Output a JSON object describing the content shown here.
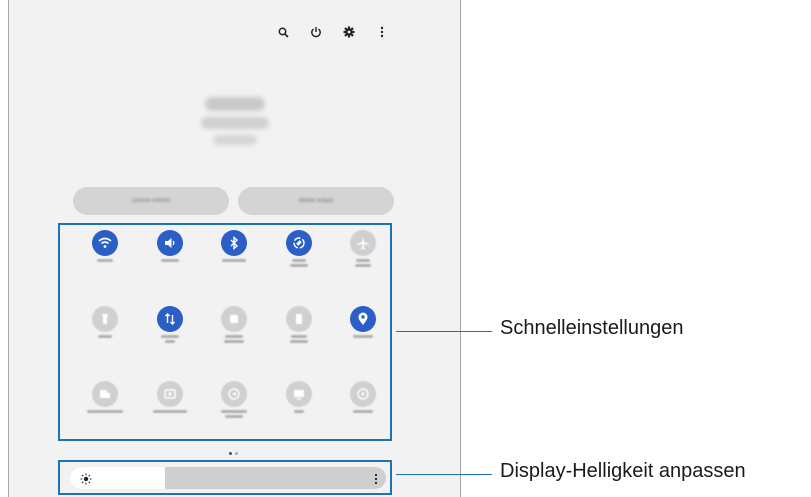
{
  "top_bar": {
    "icons": [
      "search-icon",
      "power-icon",
      "gear-icon",
      "more-vertical-icon"
    ]
  },
  "buttons": {
    "device_control": "Device control",
    "media_output": "Media output"
  },
  "quick_panel": {
    "tiles": [
      {
        "icon": "wifi-icon",
        "state": "on"
      },
      {
        "icon": "sound-icon",
        "state": "on"
      },
      {
        "icon": "bluetooth-icon",
        "state": "on"
      },
      {
        "icon": "auto-rotate-icon",
        "state": "on"
      },
      {
        "icon": "airplane-icon",
        "state": "off"
      },
      {
        "icon": "flashlight-icon",
        "state": "off"
      },
      {
        "icon": "mobile-data-icon",
        "state": "on"
      },
      {
        "icon": "mobile-hotspot-icon",
        "state": "off"
      },
      {
        "icon": "power-saving-icon",
        "state": "off"
      },
      {
        "icon": "location-icon",
        "state": "on"
      },
      {
        "icon": "link-to-windows-icon",
        "state": "off"
      },
      {
        "icon": "screen-recorder-icon",
        "state": "off"
      },
      {
        "icon": "quick-share-icon",
        "state": "off"
      },
      {
        "icon": "dex-icon",
        "state": "off"
      },
      {
        "icon": "smart-view-icon",
        "state": "off"
      }
    ],
    "page_indicator": {
      "pages": 2,
      "current": 1
    }
  },
  "brightness": {
    "level": 0.3,
    "sun_icon": "sun-icon",
    "more_icon": "more-vertical-icon"
  },
  "callouts": {
    "quick_settings": "Schnelleinstellungen",
    "brightness": "Display-Helligkeit anpassen"
  },
  "colors": {
    "accent": "#1b74b4",
    "tile_on": "#2b5fc7",
    "tile_off": "#d0d0d0",
    "panel_bg": "#f2f2f2"
  }
}
